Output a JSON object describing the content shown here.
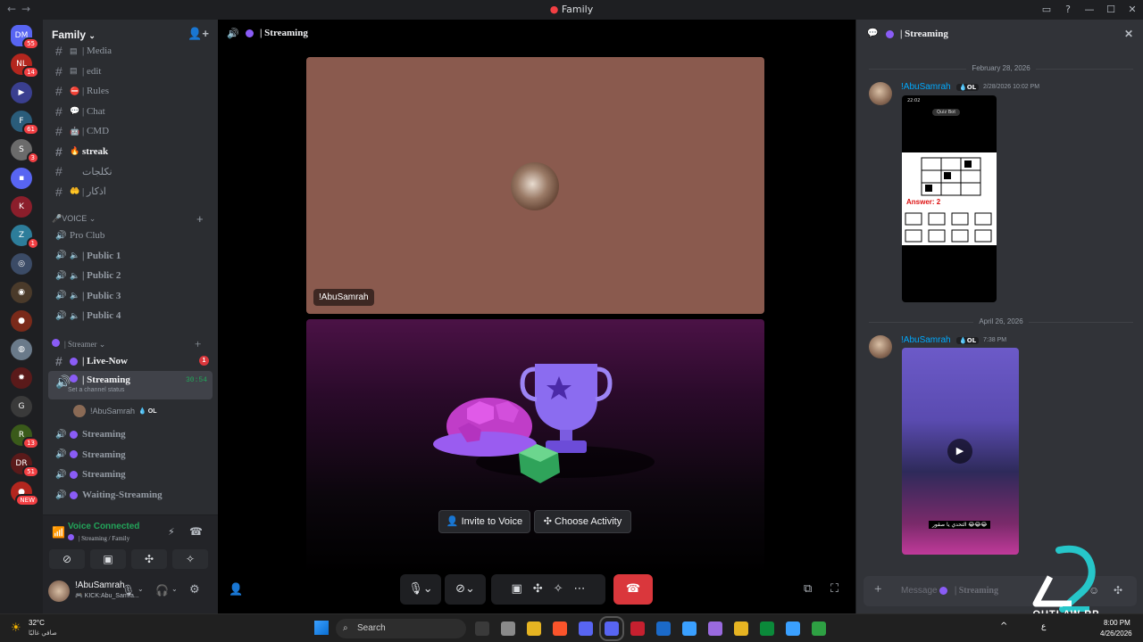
{
  "window": {
    "title": "Family"
  },
  "rail": {
    "servers": [
      {
        "label": "DM",
        "badge": "55",
        "color": "#5865f2"
      },
      {
        "label": "NL",
        "badge": "14",
        "color": "#b3261e"
      },
      {
        "label": "▶",
        "badge": "",
        "color": "#3a3f8f"
      },
      {
        "label": "F",
        "badge": "61",
        "color": "#2a5c7a"
      },
      {
        "label": "S",
        "badge": "3",
        "color": "#6b6b6b"
      },
      {
        "label": "▪",
        "badge": "",
        "color": "#5865f2"
      },
      {
        "label": "K",
        "badge": "",
        "color": "#8b1e2b"
      },
      {
        "label": "Z",
        "badge": "1",
        "color": "#2d7d9a"
      },
      {
        "label": "◎",
        "badge": "",
        "color": "#3b4b66"
      },
      {
        "label": "◉",
        "badge": "",
        "color": "#4a3a2a"
      },
      {
        "label": "●",
        "badge": "",
        "color": "#7a2a1a"
      },
      {
        "label": "◍",
        "badge": "",
        "color": "#6a7a8a"
      },
      {
        "label": "✹",
        "badge": "",
        "color": "#5a1a1a"
      },
      {
        "label": "G",
        "badge": "",
        "color": "#3a3a3a"
      },
      {
        "label": "R",
        "badge": "13",
        "color": "#3a5a1a"
      },
      {
        "label": "DR",
        "badge": "51",
        "color": "#5a1a1a"
      },
      {
        "label": "●",
        "badge": "NEW",
        "color": "#b3261e"
      }
    ]
  },
  "sidebar": {
    "guild_name": "Family",
    "text_channels": [
      {
        "name": "| Media",
        "emoji": "▤",
        "bold": false
      },
      {
        "name": "| edit",
        "emoji": "▤",
        "bold": false
      },
      {
        "name": "| Rules",
        "emoji": "⛔",
        "bold": false
      },
      {
        "name": "| Chat",
        "emoji": "💬",
        "bold": false
      },
      {
        "name": "| CMD",
        "emoji": "🤖",
        "bold": false
      },
      {
        "name": "streak",
        "emoji": "🔥",
        "bold": true
      },
      {
        "name": "نكلجات",
        "emoji": "",
        "bold": false
      },
      {
        "name": "| اذكار",
        "emoji": "🤲",
        "bold": false
      }
    ],
    "voice_category": "VOICE",
    "voice_channels": [
      {
        "name": "Pro Club"
      },
      {
        "name": "| Public 1"
      },
      {
        "name": "| Public 2"
      },
      {
        "name": "| Public 3"
      },
      {
        "name": "| Public 4"
      }
    ],
    "streamer_category": "| Streamer",
    "live_now": {
      "name": "| Live-Now",
      "badge": "1"
    },
    "active_channel": {
      "name": "| Streaming",
      "timer": "30:54",
      "status": "Set a channel status"
    },
    "active_member": {
      "name": "!AbuSamrah",
      "tag": "OL"
    },
    "other_streams": [
      {
        "name": "Streaming"
      },
      {
        "name": "Streaming"
      },
      {
        "name": "Streaming"
      },
      {
        "name": "Waiting-Streaming"
      }
    ]
  },
  "voice_panel": {
    "status": "Voice Connected",
    "channel": "| Streaming / Family"
  },
  "user_panel": {
    "name": "!AbuSamrah",
    "sub": "KICK:Abu_Samra..."
  },
  "stage": {
    "header": "| Streaming",
    "tile_name": "!AbuSamrah",
    "invite_label": "Invite to Voice",
    "activity_label": "Choose Activity"
  },
  "chat": {
    "header": "| Streaming",
    "date1": "February 28, 2026",
    "msg1": {
      "author": "!AbuSamrah",
      "tag": "OL",
      "time": "2/28/2026 10:02 PM"
    },
    "screenshot": {
      "top_left": "22:02",
      "title": "Quiz Bot",
      "answer": "Answer: 2"
    },
    "date2": "April 26, 2026",
    "msg2": {
      "author": "!AbuSamrah",
      "tag": "OL",
      "time": "7:38 PM"
    },
    "video_caption": "التحدي يا صقور 😂😂😂",
    "placeholder_prefix": "Message",
    "placeholder_channel": "| Streaming"
  },
  "taskbar": {
    "weather_temp": "32°C",
    "weather_desc": "صافي غالبًا",
    "search_placeholder": "Search",
    "time": "8:00 PM",
    "date": "4/26/2026",
    "lang": "ع"
  },
  "watermark": {
    "text": "OUTLAW RP"
  },
  "colors": {
    "accent": "#5865f2",
    "danger": "#da373c",
    "online": "#23a55a",
    "link": "#00a8fc"
  }
}
